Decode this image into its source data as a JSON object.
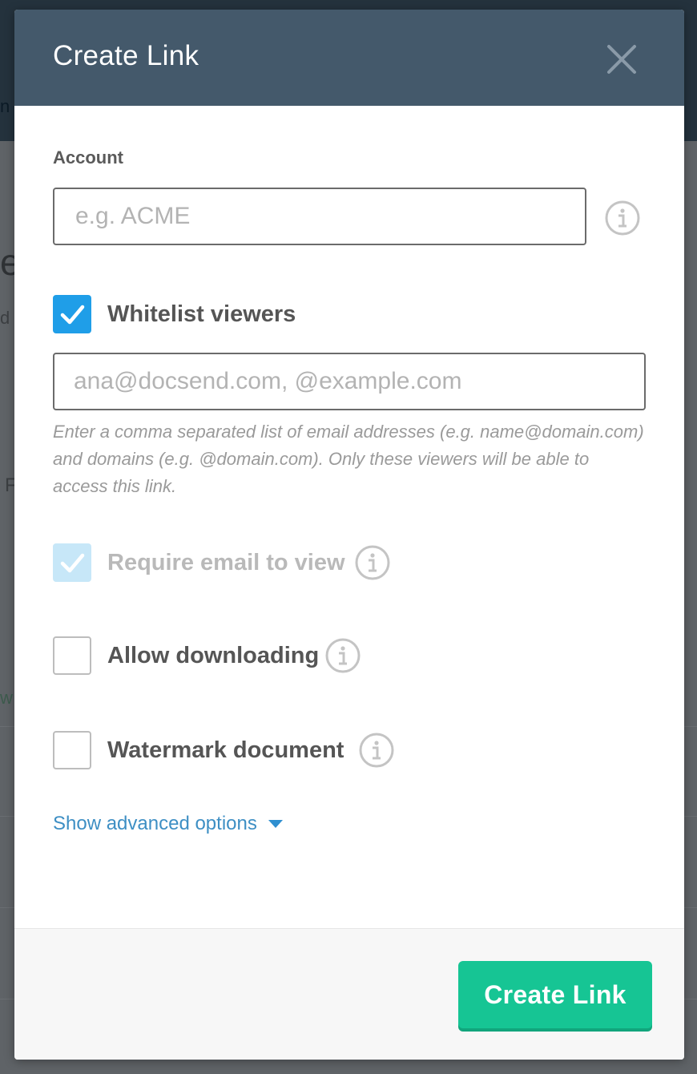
{
  "modal": {
    "title": "Create Link",
    "account": {
      "label": "Account",
      "placeholder": "e.g. ACME",
      "value": ""
    },
    "whitelist": {
      "label": "Whitelist viewers",
      "checked": true,
      "placeholder": "ana@docsend.com, @example.com",
      "value": "",
      "help_text": "Enter a comma separated list of email addresses (e.g. name@domain.com) and domains (e.g. @domain.com). Only these viewers will be able to access this link."
    },
    "require_email": {
      "label": "Require email to view",
      "checked": true,
      "disabled": true
    },
    "allow_downloading": {
      "label": "Allow downloading",
      "checked": false
    },
    "watermark": {
      "label": "Watermark document",
      "checked": false
    },
    "advanced_link": "Show advanced options",
    "submit_label": "Create Link"
  },
  "colors": {
    "header_bg": "#44596b",
    "checkbox_blue": "#1f9ee8",
    "link_blue": "#3e8fc4",
    "button_green": "#16c594"
  },
  "icons": [
    "close-icon",
    "info-icon",
    "checkmark-icon",
    "caret-down-icon"
  ]
}
